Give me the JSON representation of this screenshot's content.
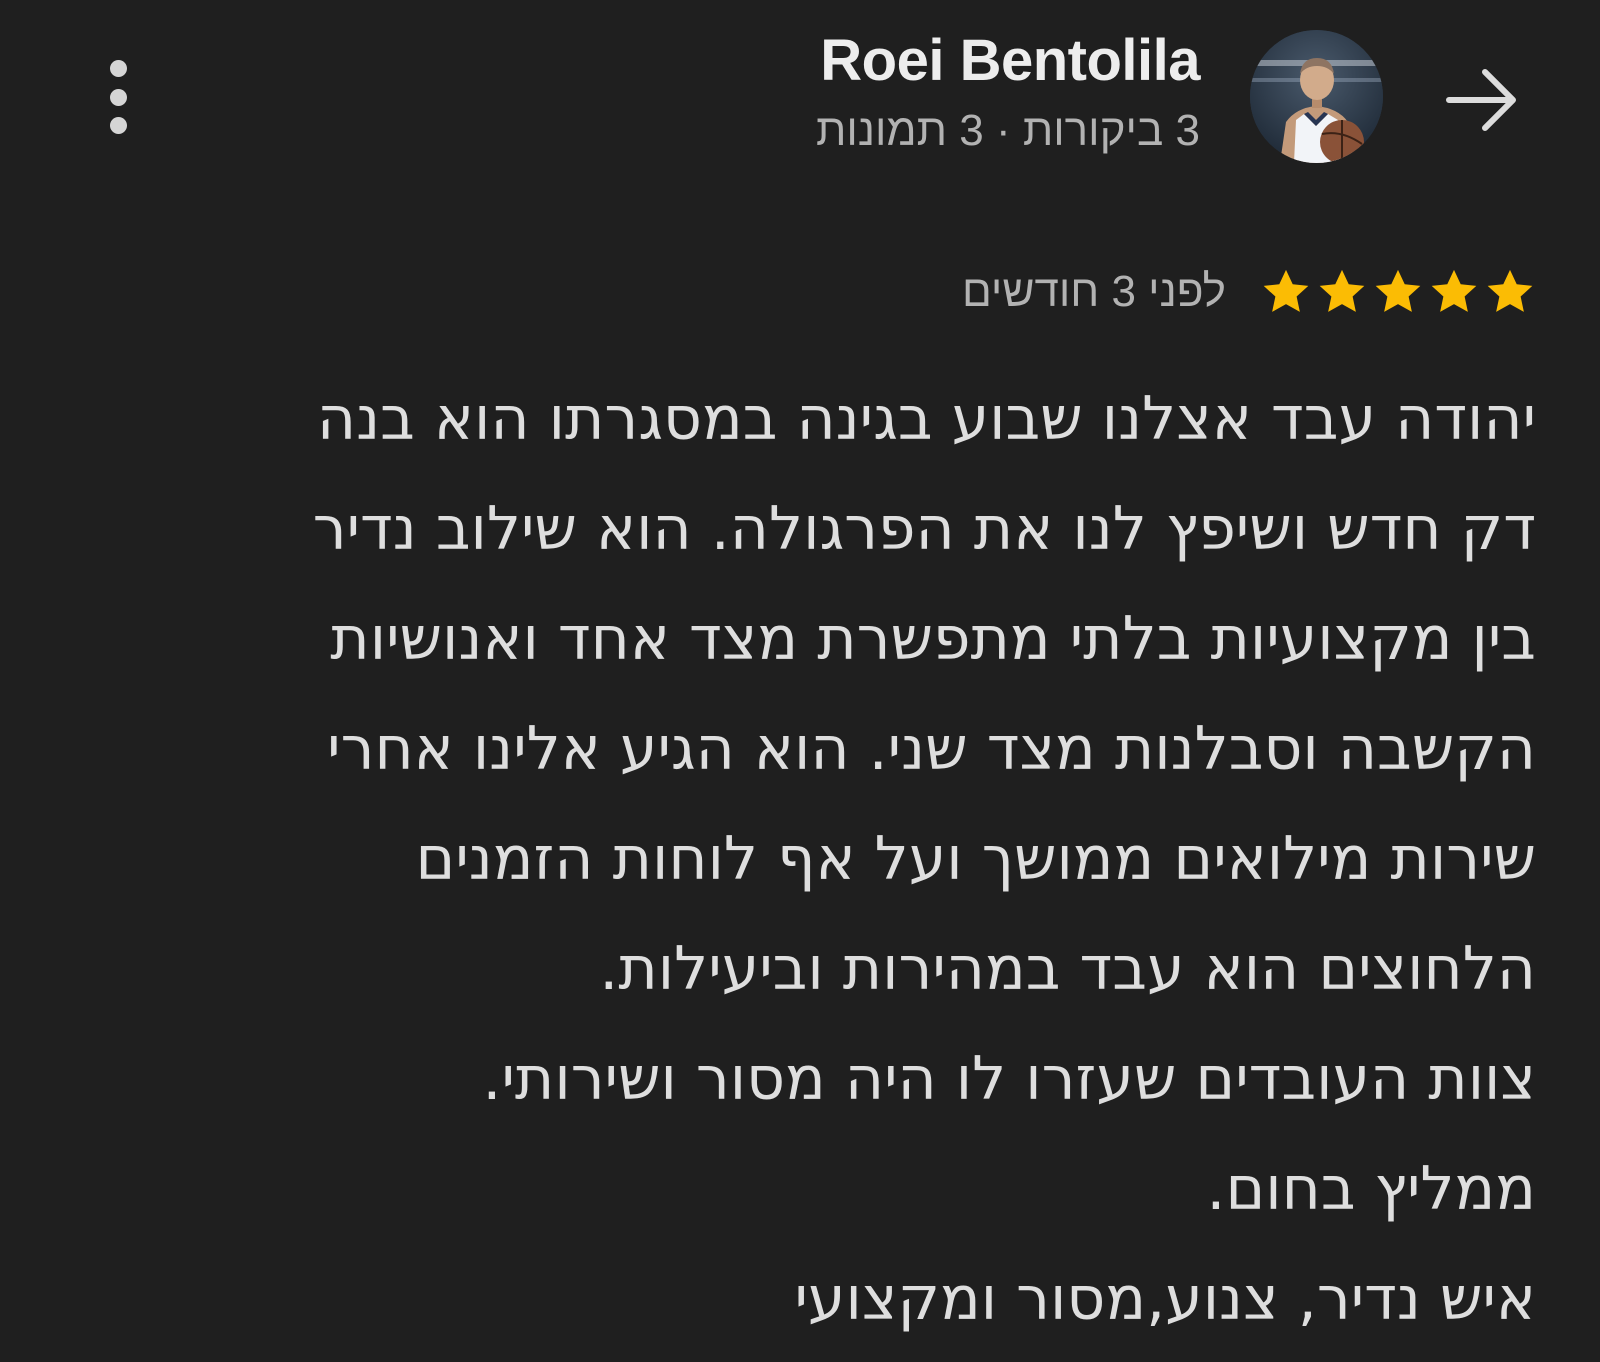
{
  "header": {
    "reviewer_name": "Roei Bentolila",
    "reviewer_meta": "3 ביקורות · 3 תמונות",
    "back_icon": "arrow-forward-icon",
    "more_icon": "more-vert-icon"
  },
  "review": {
    "rating": 5,
    "rating_max": 5,
    "time_ago": "לפני 3 חודשים",
    "lines": [
      "יהודה עבד אצלנו שבוע בגינה במסגרתו הוא בנה",
      "דק חדש ושיפץ לנו את הפרגולה. הוא שילוב נדיר",
      "בין מקצועיות בלתי מתפשרת מצד אחד ואנושיות",
      "הקשבה וסבלנות מצד שני. הוא הגיע אלינו אחרי",
      "שירות מילואים ממושך ועל אף לוחות הזמנים",
      "הלחוצים הוא עבד במהירות וביעילות.",
      "צוות העובדים שעזרו לו היה מסור ושירותי.",
      "ממליץ בחום.",
      "איש נדיר, צנוע,מסור ומקצועי"
    ]
  },
  "colors": {
    "background": "#1f1f1f",
    "star": "#fbbc04",
    "primary_text": "#ededed",
    "secondary_text": "#b2b2b2"
  }
}
